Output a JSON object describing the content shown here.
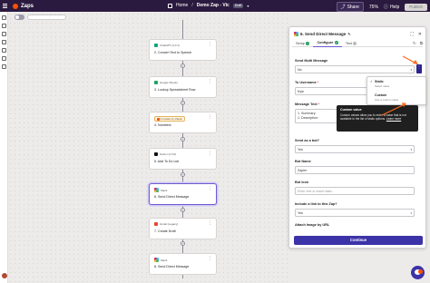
{
  "app": {
    "title": "Zaps"
  },
  "header": {
    "home_label": "Home",
    "zap_name": "Demo Zap - Vic",
    "status_badge": "Draft",
    "share_label": "Share",
    "zoom": "75%",
    "help_label": "Help",
    "publish_label": "Publish"
  },
  "nodes": [
    {
      "app": "ChatGPT (4.0.1)",
      "title": "2. Convert Text to Speech",
      "color": "#10a37f"
    },
    {
      "app": "Google Sheets",
      "title": "3. Lookup Spreadsheet Row",
      "color": "#1fa463"
    },
    {
      "app": "Formatter by Zapier",
      "title": "4. Numbers",
      "color": "#ff4f00"
    },
    {
      "app": "Notion (2.0.0)",
      "title": "5. Add To Do List",
      "color": "#111111"
    },
    {
      "app": "Slack",
      "title": "6. Send Direct Message",
      "color": "#611f69"
    },
    {
      "app": "Gmail (Legacy)",
      "title": "7. Create Draft",
      "color": "#ea4335"
    },
    {
      "app": "Slack",
      "title": "8. Send Direct Message",
      "color": "#611f69"
    }
  ],
  "panel": {
    "title": "6. Send Direct Message",
    "tabs": {
      "setup": "Setup",
      "configure": "Configure",
      "test": "Test"
    },
    "fields": {
      "multi_message_label": "Send Multi Message",
      "multi_message_value": "No",
      "username_label": "To Username",
      "username_value": "Kyle",
      "message_label": "Message Text",
      "message_line1": "1. Summary:",
      "message_line2": "1. Description:",
      "send_as_bot_label": "Send as a bot?",
      "send_as_bot_value": "Yes",
      "bot_name_label": "Bot Name",
      "bot_name_value": "Zapier",
      "bot_icon_label": "Bot Icon",
      "bot_icon_placeholder": "Enter text or insert data...",
      "include_link_label": "Include a link to this Zap?",
      "include_link_value": "Yes",
      "attach_image_label": "Attach Image by URL"
    },
    "continue_label": "Continue"
  },
  "dropdown": {
    "static_label": "Static",
    "static_sub": "Select value",
    "custom_label": "Custom",
    "custom_sub": "Use a custom value"
  },
  "tooltip": {
    "title": "Custom value",
    "body_pre": "Custom values allow you to enter a value that is not available in the list of static options. ",
    "link": "Learn more"
  },
  "colors": {
    "topbar": "#2b1a3f",
    "accent": "#3c33a8",
    "arrow": "#ff6a1a",
    "brand": "#ff4f00"
  }
}
